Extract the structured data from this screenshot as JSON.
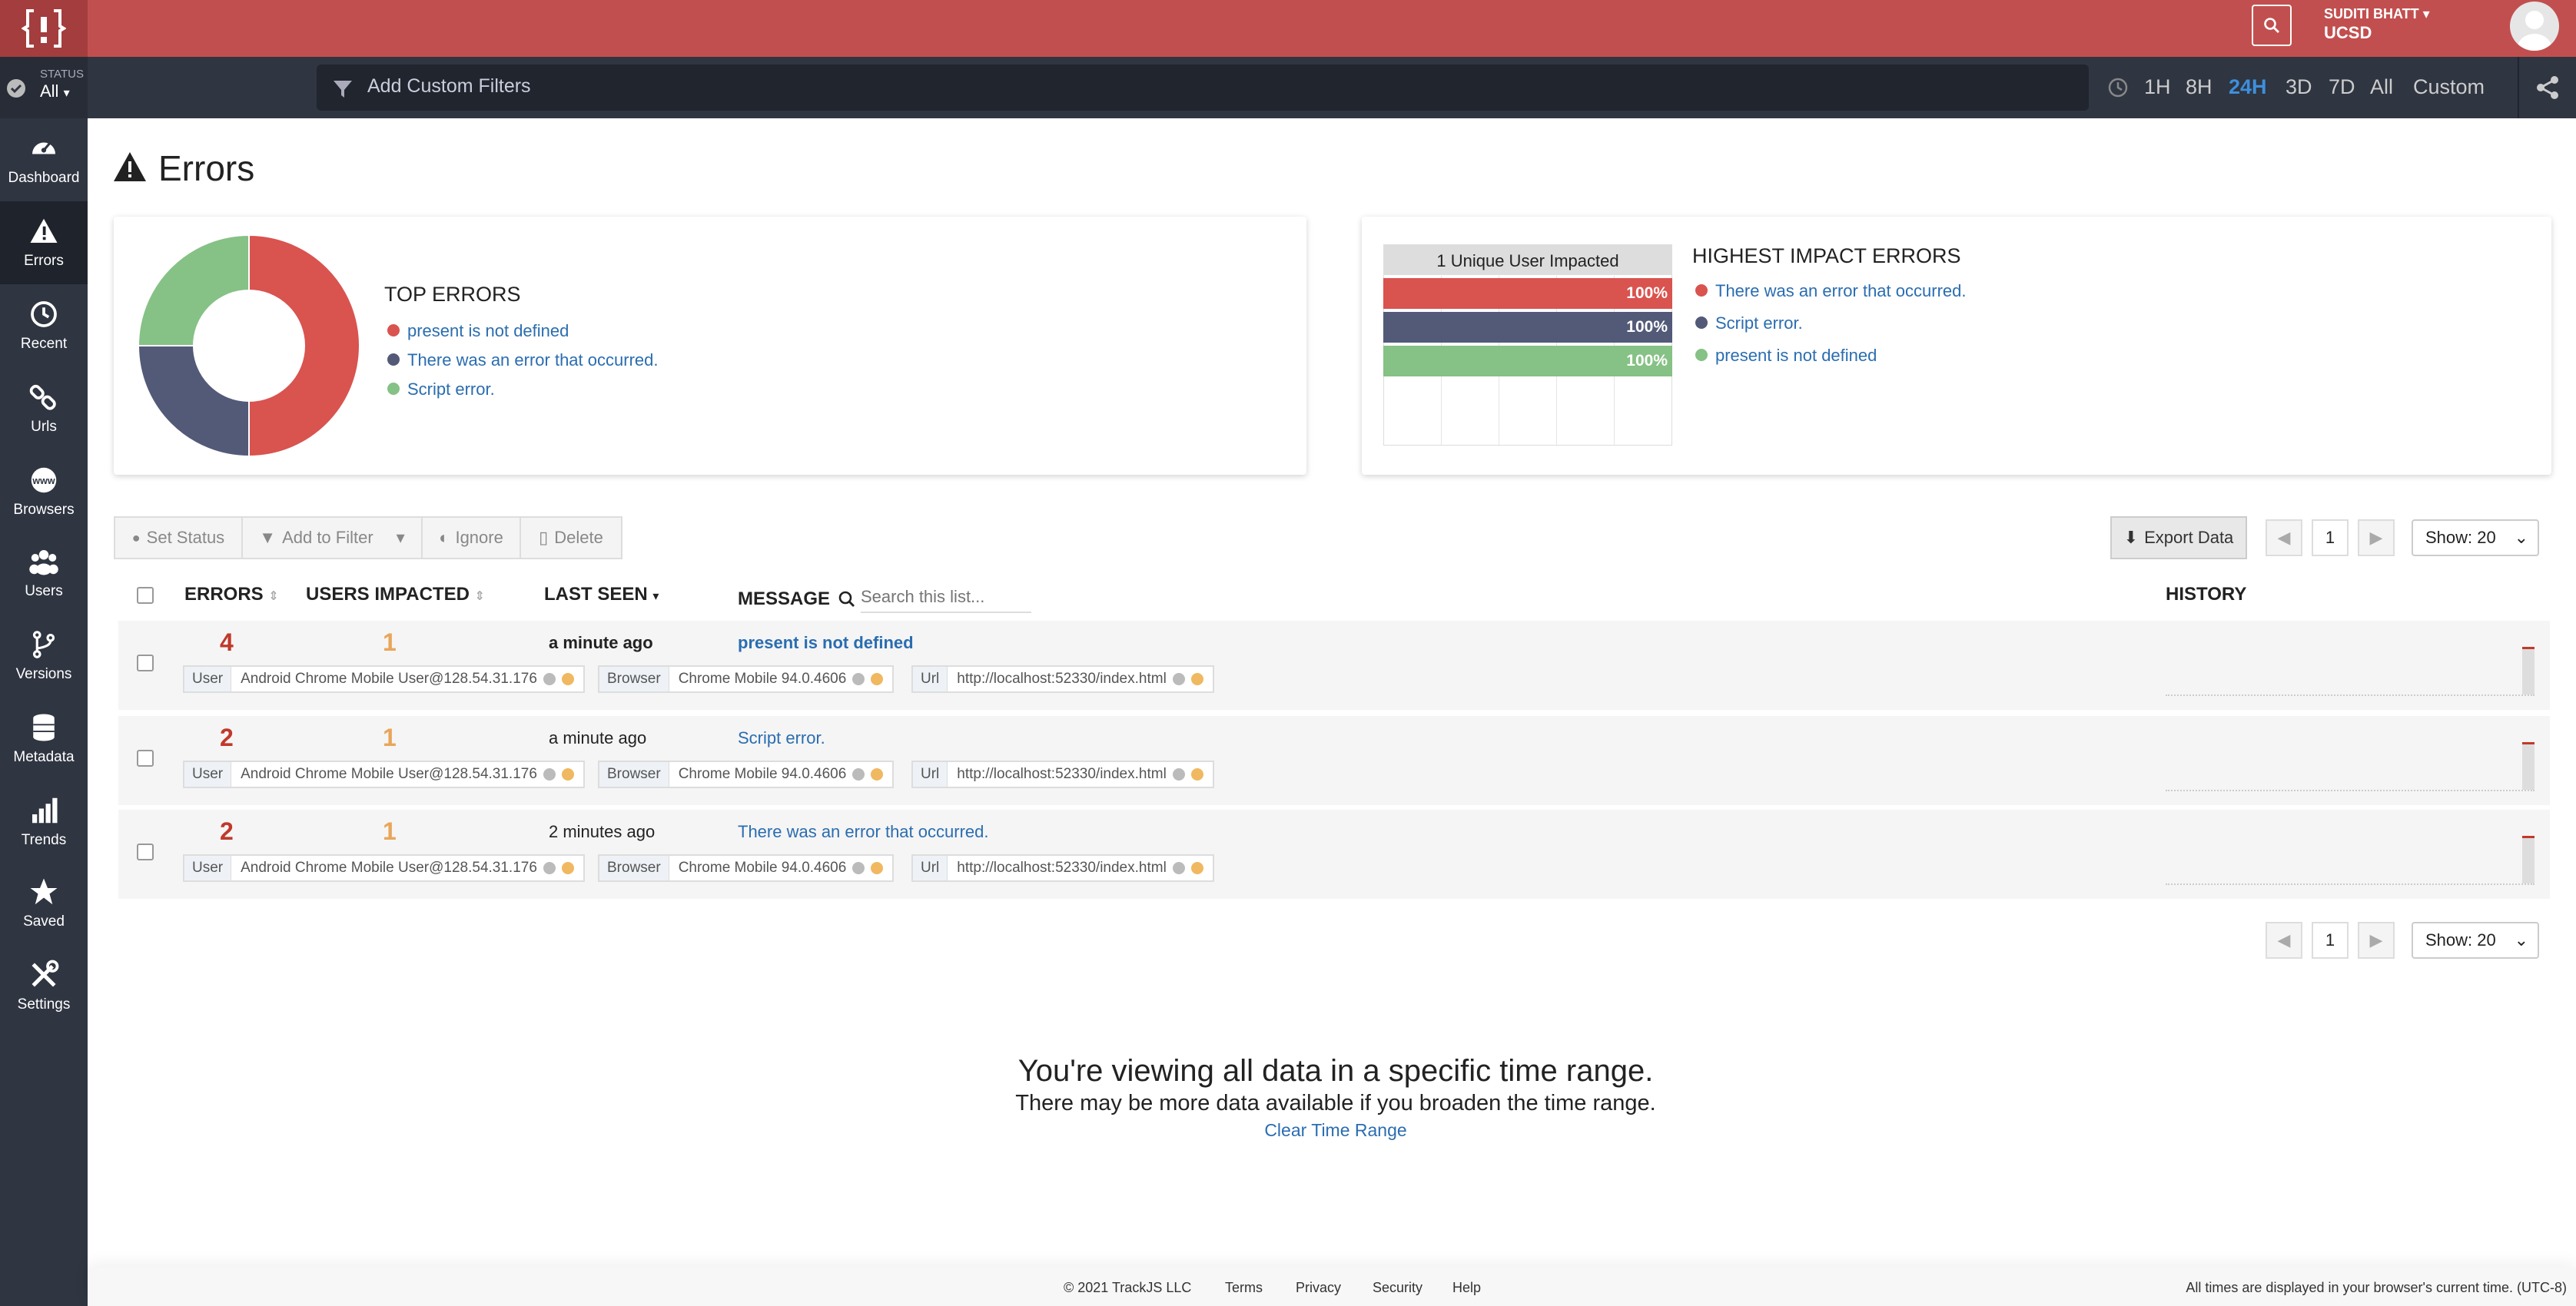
{
  "header": {
    "user_name": "SUDITI BHATT",
    "org": "UCSD"
  },
  "status": {
    "label": "STATUS",
    "value": "All"
  },
  "filter": {
    "placeholder": "Add Custom Filters"
  },
  "time_ranges": [
    "1H",
    "8H",
    "24H",
    "3D",
    "7D",
    "All",
    "Custom"
  ],
  "active_range": "24H",
  "sidebar": {
    "items": [
      {
        "label": "Dashboard",
        "icon": "dashboard-icon"
      },
      {
        "label": "Errors",
        "icon": "warning-icon"
      },
      {
        "label": "Recent",
        "icon": "clock-icon"
      },
      {
        "label": "Urls",
        "icon": "link-icon"
      },
      {
        "label": "Browsers",
        "icon": "www-icon"
      },
      {
        "label": "Users",
        "icon": "users-icon"
      },
      {
        "label": "Versions",
        "icon": "branch-icon"
      },
      {
        "label": "Metadata",
        "icon": "database-icon"
      },
      {
        "label": "Trends",
        "icon": "bar-chart-icon"
      },
      {
        "label": "Saved",
        "icon": "star-icon"
      },
      {
        "label": "Settings",
        "icon": "tools-icon"
      }
    ]
  },
  "page": {
    "title": "Errors"
  },
  "top_errors": {
    "heading": "TOP ERRORS",
    "items": [
      {
        "label": "present is not defined",
        "color": "#d9534f",
        "share": 0.5
      },
      {
        "label": "There was an error that occurred.",
        "color": "#535a78",
        "share": 0.25
      },
      {
        "label": "Script error.",
        "color": "#86c185",
        "share": 0.25
      }
    ]
  },
  "impact": {
    "heading": "HIGHEST IMPACT ERRORS",
    "bar_header": "1 Unique User Impacted",
    "items": [
      {
        "label": "There was an error that occurred.",
        "color": "#d9534f",
        "pct": "100%"
      },
      {
        "label": "Script error.",
        "color": "#535a78",
        "pct": "100%"
      },
      {
        "label": "present is not defined",
        "color": "#86c185",
        "pct": "100%"
      }
    ]
  },
  "toolbar": {
    "set_status": "Set Status",
    "add_filter": "Add to Filter",
    "ignore": "Ignore",
    "delete": "Delete",
    "export": "Export Data"
  },
  "pager": {
    "page": "1",
    "show": "Show: 20"
  },
  "table": {
    "headers": {
      "errors": "ERRORS",
      "users": "USERS IMPACTED",
      "last_seen": "LAST SEEN",
      "message": "MESSAGE",
      "history": "HISTORY"
    },
    "search_placeholder": "Search this list...",
    "rows": [
      {
        "errors": "4",
        "users": "1",
        "last_seen": "a minute ago",
        "message": "present is not defined",
        "user_key": "User",
        "user": "Android Chrome Mobile User@128.54.31.176",
        "browser_key": "Browser",
        "browser": "Chrome Mobile 94.0.4606",
        "url_key": "Url",
        "url": "http://localhost:52330/index.html",
        "bold": true
      },
      {
        "errors": "2",
        "users": "1",
        "last_seen": "a minute ago",
        "message": "Script error.",
        "user_key": "User",
        "user": "Android Chrome Mobile User@128.54.31.176",
        "browser_key": "Browser",
        "browser": "Chrome Mobile 94.0.4606",
        "url_key": "Url",
        "url": "http://localhost:52330/index.html",
        "bold": false
      },
      {
        "errors": "2",
        "users": "1",
        "last_seen": "2 minutes ago",
        "message": "There was an error that occurred.",
        "user_key": "User",
        "user": "Android Chrome Mobile User@128.54.31.176",
        "browser_key": "Browser",
        "browser": "Chrome Mobile 94.0.4606",
        "url_key": "Url",
        "url": "http://localhost:52330/index.html",
        "bold": false
      }
    ]
  },
  "notice": {
    "title": "You're viewing all data in a specific time range.",
    "subtitle": "There may be more data available if you broaden the time range.",
    "link": "Clear Time Range"
  },
  "footer": {
    "copyright": "© 2021 TrackJS LLC",
    "links": [
      "Terms",
      "Privacy",
      "Security",
      "Help"
    ],
    "note": "All times are displayed in your browser's current time. (UTC-8)"
  }
}
